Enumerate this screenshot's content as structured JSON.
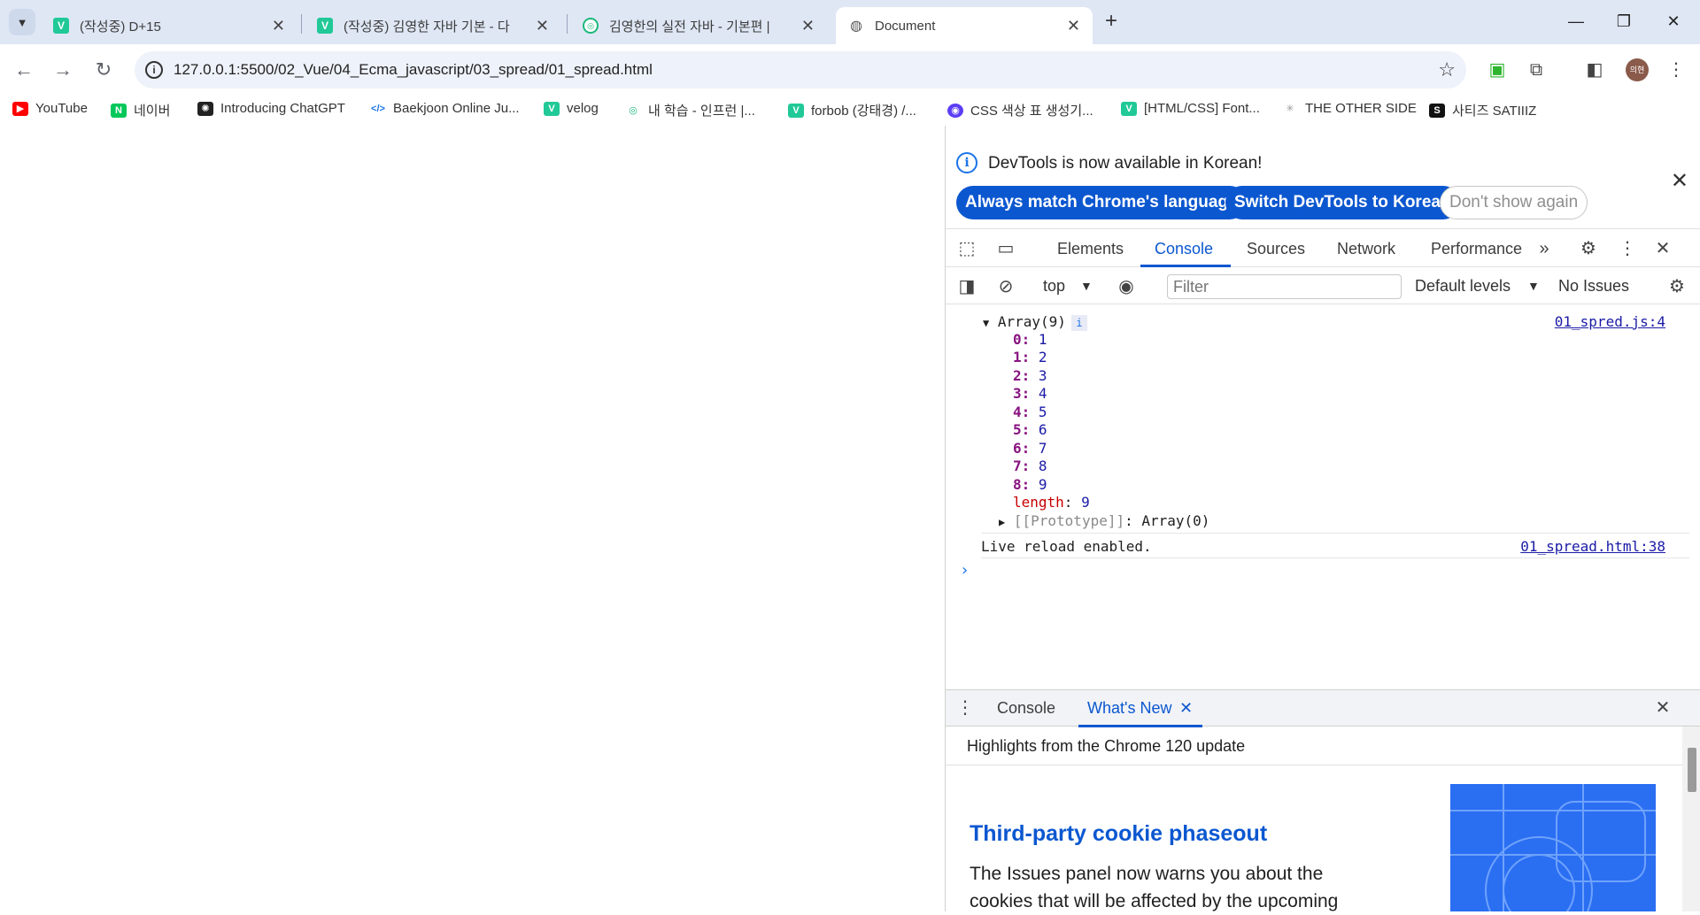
{
  "browser": {
    "tabs": [
      {
        "title": "(작성중) D+15",
        "favicon": "v-icon",
        "active": false
      },
      {
        "title": "(작성중) 김영한 자바 기본 - 다",
        "favicon": "v-icon",
        "active": false
      },
      {
        "title": "김영한의 실전 자바 - 기본편 |",
        "favicon": "inflearn-icon",
        "active": false
      },
      {
        "title": "Document",
        "favicon": "globe-icon",
        "active": true
      }
    ],
    "new_tab_label": "+",
    "url": "127.0.0.1:5500/02_Vue/04_Ecma_javascript/03_spread/01_spread.html",
    "avatar_text": "의현",
    "bookmarks": [
      {
        "label": "YouTube",
        "icon": "youtube-icon",
        "color": "#ff0000"
      },
      {
        "label": "네이버",
        "icon": "naver-icon",
        "color": "#03c75a"
      },
      {
        "label": "Introducing ChatGPT",
        "icon": "chatgpt-icon",
        "color": "#222222"
      },
      {
        "label": "Baekjoon Online Ju...",
        "icon": "code-icon",
        "color": "#1a73e8"
      },
      {
        "label": "velog",
        "icon": "velog-icon",
        "color": "#20c997"
      },
      {
        "label": "내 학습 - 인프런 |...",
        "icon": "inflearn-icon",
        "color": "#1bb97a"
      },
      {
        "label": "forbob (강태경) /...",
        "icon": "velog-icon",
        "color": "#20c997"
      },
      {
        "label": "CSS 색상 표 생성기...",
        "icon": "color-icon",
        "color": "#5b3df5"
      },
      {
        "label": "[HTML/CSS] Font...",
        "icon": "velog-icon",
        "color": "#20c997"
      },
      {
        "label": "THE OTHER SIDE",
        "icon": "sparkle-icon",
        "color": "#999999"
      },
      {
        "label": "사티즈 SATIIIZ",
        "icon": "s-icon",
        "color": "#111111"
      }
    ]
  },
  "devtools": {
    "infobar": {
      "message": "DevTools is now available in Korean!",
      "btn_match": "Always match Chrome's language",
      "btn_switch": "Switch DevTools to Korean",
      "btn_dismiss": "Don't show again"
    },
    "tabs": [
      "Elements",
      "Console",
      "Sources",
      "Network",
      "Performance"
    ],
    "active_tab": "Console",
    "console_bar": {
      "context": "top",
      "filter_placeholder": "Filter",
      "levels": "Default levels",
      "issues": "No Issues"
    },
    "log": {
      "array_label": "Array(9)",
      "array_source": "01_spred.js:4",
      "entries": [
        {
          "key": "0",
          "value": "1"
        },
        {
          "key": "1",
          "value": "2"
        },
        {
          "key": "2",
          "value": "3"
        },
        {
          "key": "3",
          "value": "4"
        },
        {
          "key": "4",
          "value": "5"
        },
        {
          "key": "5",
          "value": "6"
        },
        {
          "key": "6",
          "value": "7"
        },
        {
          "key": "7",
          "value": "8"
        },
        {
          "key": "8",
          "value": "9"
        }
      ],
      "length_key": "length",
      "length_value": "9",
      "prototype_key": "[[Prototype]]",
      "prototype_value": "Array(0)",
      "reload_message": "Live reload enabled.",
      "reload_source": "01_spread.html:38"
    },
    "drawer": {
      "tabs": [
        "Console",
        "What's New"
      ],
      "active_tab": "What's New",
      "highlights": "Highlights from the Chrome 120 update",
      "article_title": "Third-party cookie phaseout",
      "article_body": "The Issues panel now warns you about the cookies that will be affected by the upcoming"
    }
  }
}
